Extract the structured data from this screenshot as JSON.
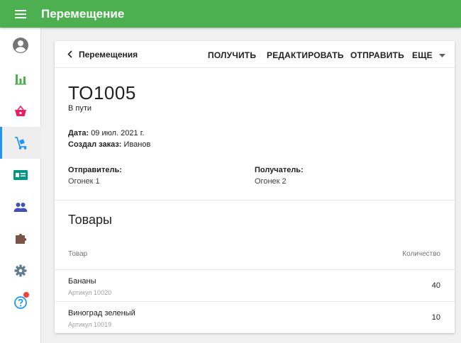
{
  "app": {
    "title": "Перемещение",
    "accent_color": "#4caf50"
  },
  "sidebar": {
    "items": [
      {
        "icon": "account-circle-icon",
        "color": "#757575"
      },
      {
        "icon": "bar-chart-icon",
        "color": "#4caf50"
      },
      {
        "icon": "shopping-basket-icon",
        "color": "#e91e63"
      },
      {
        "icon": "dolly-cart-icon",
        "color": "#2196f3",
        "active": true
      },
      {
        "icon": "contact-card-icon",
        "color": "#009688"
      },
      {
        "icon": "people-icon",
        "color": "#3f51b5"
      },
      {
        "icon": "puzzle-icon",
        "color": "#795548"
      },
      {
        "icon": "gear-icon",
        "color": "#607d8b"
      },
      {
        "icon": "help-circle-icon",
        "color": "#2196f3",
        "badge": true
      }
    ]
  },
  "toolbar": {
    "back_label": "Перемещения",
    "actions": {
      "receive": "ПОЛУЧИТЬ",
      "edit": "РЕДАКТИРОВАТЬ",
      "send": "ОТПРАВИТЬ",
      "more": "ЕЩЕ"
    }
  },
  "document": {
    "number": "ТО1005",
    "status": "В пути",
    "date_label": "Дата:",
    "date_value": "09 июл. 2021 г.",
    "author_label": "Создал заказ:",
    "author_value": "Иванов",
    "sender_label": "Отправитель:",
    "sender_value": "Огонек 1",
    "receiver_label": "Получатель:",
    "receiver_value": "Огонек 2"
  },
  "goods": {
    "title": "Товары",
    "columns": {
      "name": "Товар",
      "qty": "Количество"
    },
    "rows": [
      {
        "name": "Бананы",
        "sku": "Артикул 10020",
        "qty": "40"
      },
      {
        "name": "Виноград зеленый",
        "sku": "Артикул 10019",
        "qty": "10"
      }
    ]
  }
}
